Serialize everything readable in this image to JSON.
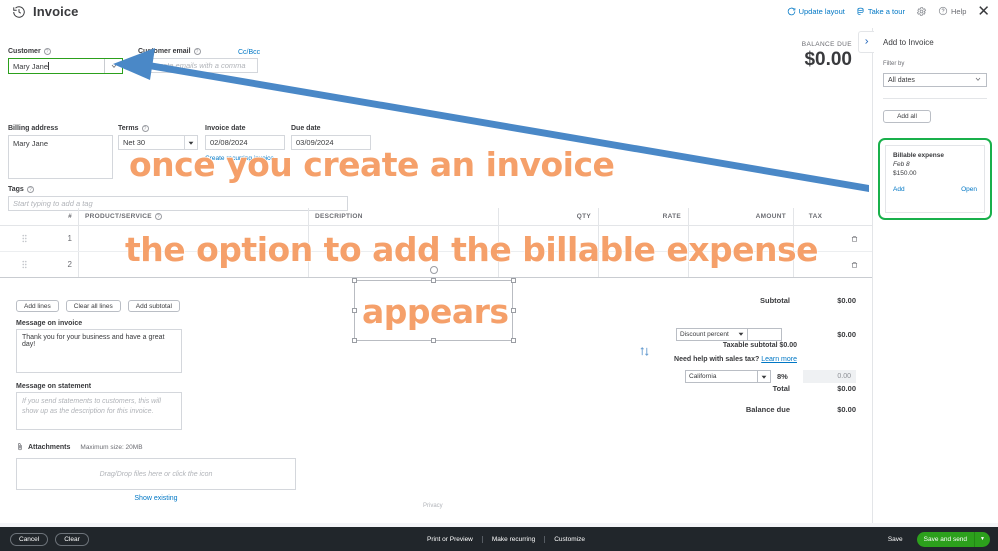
{
  "header": {
    "title": "Invoice",
    "title_icon": "clock-history-icon",
    "actions": [
      {
        "label": "Update layout",
        "icon": "refresh-icon"
      },
      {
        "label": "Take a tour",
        "icon": "tour-icon"
      }
    ],
    "gear_icon": "gear-icon",
    "help_label": "Help",
    "help_icon": "question-circle-icon",
    "close_icon": "close-icon"
  },
  "form": {
    "customer_label": "Customer",
    "customer_value": "Mary Jane",
    "customer_email_label": "Customer email",
    "customer_email_placeholder": "Separate emails with a comma",
    "ccbcc_label": "Cc/Bcc",
    "balance_due_label": "BALANCE DUE",
    "balance_due_value": "$0.00",
    "billing_address_label": "Billing address",
    "billing_address_value": "Mary Jane",
    "terms_label": "Terms",
    "terms_value": "Net 30",
    "invoice_date_label": "Invoice date",
    "invoice_date_value": "02/08/2024",
    "due_date_label": "Due date",
    "due_date_value": "03/09/2024",
    "create_recurring_label": "Create recurring invoice",
    "tags_label": "Tags",
    "tags_placeholder": "Start typing to add a tag"
  },
  "line_table": {
    "columns": [
      "#",
      "PRODUCT/SERVICE",
      "DESCRIPTION",
      "QTY",
      "RATE",
      "AMOUNT",
      "TAX"
    ],
    "rows": [
      {
        "num": "1",
        "product": "",
        "description": "",
        "qty": "",
        "rate": "",
        "amount": "",
        "tax": ""
      },
      {
        "num": "2",
        "product": "",
        "description": "",
        "qty": "",
        "rate": "",
        "amount": "",
        "tax": ""
      }
    ],
    "drag_icon": "drag-handle-icon",
    "trash_icon": "trash-icon",
    "buttons": [
      "Add lines",
      "Clear all lines",
      "Add subtotal"
    ]
  },
  "messages": {
    "message_on_invoice_label": "Message on invoice",
    "message_on_invoice_value": "Thank you for your business and have a great day!",
    "message_on_statement_label": "Message on statement",
    "message_on_statement_placeholder": "If you send statements to customers, this will show up as the description for this invoice.",
    "attachments_label": "Attachments",
    "attachments_icon": "paperclip-icon",
    "max_size_label": "Maximum size: 20MB",
    "dropzone_text": "Drag/Drop files here or click the icon",
    "show_existing_label": "Show existing",
    "privacy_label": "Privacy"
  },
  "totals": {
    "subtotal_label": "Subtotal",
    "subtotal_value": "$0.00",
    "discount_select": "Discount percent",
    "discount_input": "",
    "discount_value": "$0.00",
    "taxable_subtotal_label": "Taxable subtotal $0.00",
    "sales_tax_help": "Need help with sales tax?",
    "learn_more_label": "Learn more",
    "tax_region": "California",
    "tax_percent": "8%",
    "tax_amount": "0.00",
    "total_label": "Total",
    "total_value": "$0.00",
    "balance_due_label": "Balance due",
    "balance_due_value": "$0.00",
    "swap_icon": "swap-vertical-icon"
  },
  "right_panel": {
    "title": "Add to Invoice",
    "filter_label": "Filter by",
    "filter_value": "All dates",
    "add_all_label": "Add all",
    "expense": {
      "title": "Billable expense",
      "date": "Feb 8",
      "amount": "$150.00",
      "add_label": "Add",
      "open_label": "Open"
    },
    "collapse_icon": "chevron-right-icon",
    "highlight_color": "#19b04b"
  },
  "bottom_bar": {
    "cancel_label": "Cancel",
    "clear_label": "Clear",
    "center_links": [
      "Print or Preview",
      "Make recurring",
      "Customize"
    ],
    "save_label": "Save",
    "save_and_send_label": "Save and send",
    "dropdown_icon": "caret-down-icon",
    "green_color": "#2ca01c"
  },
  "annotations": {
    "text_line_1": "once you create an invoice",
    "text_line_2": "the option to add the billable  expense",
    "text_line_3": "appears",
    "text_color": "#f5a06a",
    "arrow_color": "#4a88c7",
    "arrow_icon": "left-arrow-annotation"
  }
}
